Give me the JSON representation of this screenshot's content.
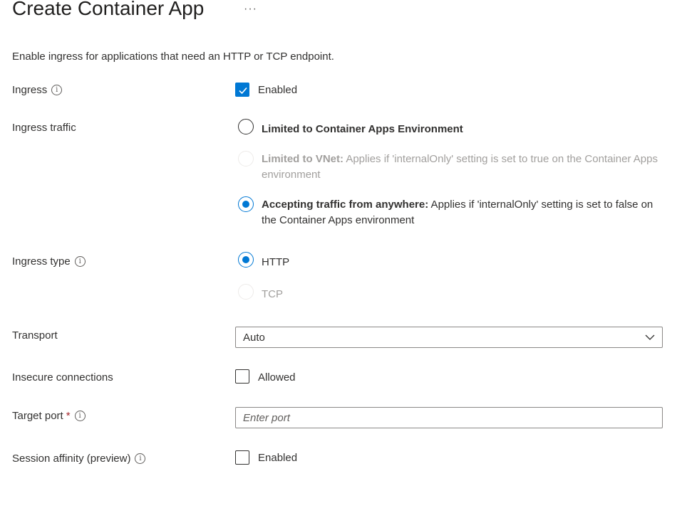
{
  "header": {
    "title": "Create Container App",
    "more_label": "···"
  },
  "description": "Enable ingress for applications that need an HTTP or TCP endpoint.",
  "ingress": {
    "label": "Ingress",
    "checkbox_label": "Enabled",
    "checked": true
  },
  "ingress_traffic": {
    "label": "Ingress traffic",
    "options": [
      {
        "title": "Limited to Container Apps Environment",
        "detail": "",
        "selected": false,
        "disabled": false
      },
      {
        "title": "Limited to VNet:",
        "detail": " Applies if 'internalOnly' setting is set to true on the Container Apps environment",
        "selected": false,
        "disabled": true
      },
      {
        "title": "Accepting traffic from anywhere:",
        "detail": " Applies if 'internalOnly' setting is set to false on the Container Apps environment",
        "selected": true,
        "disabled": false
      }
    ]
  },
  "ingress_type": {
    "label": "Ingress type",
    "options": [
      {
        "label": "HTTP",
        "selected": true,
        "disabled": false
      },
      {
        "label": "TCP",
        "selected": false,
        "disabled": true
      }
    ]
  },
  "transport": {
    "label": "Transport",
    "value": "Auto"
  },
  "insecure_connections": {
    "label": "Insecure connections",
    "checkbox_label": "Allowed",
    "checked": false
  },
  "target_port": {
    "label": "Target port",
    "required_mark": "*",
    "placeholder": "Enter port",
    "value": ""
  },
  "session_affinity": {
    "label": "Session affinity (preview)",
    "checkbox_label": "Enabled",
    "checked": false
  },
  "icons": {
    "info": "info-icon",
    "check": "checkmark-icon",
    "chevron": "chevron-down-icon",
    "more": "more-icon"
  },
  "colors": {
    "accent": "#0078d4",
    "text": "#323130",
    "disabled_text": "#a19f9d",
    "required": "#a4262c"
  }
}
